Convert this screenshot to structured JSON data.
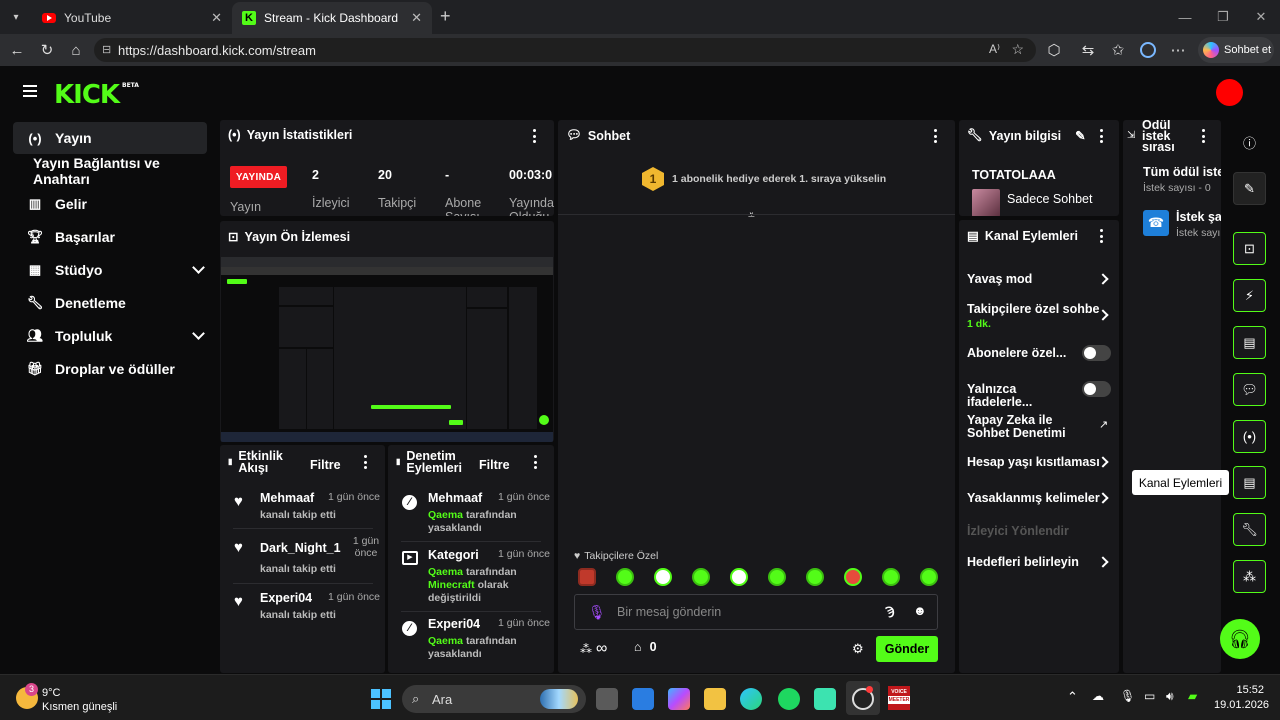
{
  "browser": {
    "tabs": [
      {
        "title": "YouTube"
      },
      {
        "title": "Stream - Kick Dashboard"
      }
    ],
    "url": "https://dashboard.kick.com/stream",
    "copilot_label": "Sohbet et"
  },
  "brand": {
    "logo": "KICK",
    "beta": "BETA",
    "accent": "#53fc18"
  },
  "sidebar": {
    "items": [
      {
        "label": "Yayın",
        "icon": "broadcast-icon"
      },
      {
        "label": "Yayın Bağlantısı ve Anahtarı"
      },
      {
        "label": "Gelir",
        "icon": "chart-icon"
      },
      {
        "label": "Başarılar",
        "icon": "trophy-icon"
      },
      {
        "label": "Stüdyo",
        "icon": "studio-icon"
      },
      {
        "label": "Denetleme",
        "icon": "wrench-icon"
      },
      {
        "label": "Topluluk",
        "icon": "users-icon"
      },
      {
        "label": "Droplar ve ödüller",
        "icon": "gift-icon"
      }
    ]
  },
  "stats": {
    "title": "Yayın İstatistikleri",
    "live_badge": "YAYINDA",
    "live_label": "Yayın",
    "viewers_value": "2",
    "viewers_label": "İzleyici",
    "followers_value": "20",
    "followers_label": "Takipçi",
    "subs_value": "-",
    "subs_label": "Abone Sayısı",
    "uptime_value": "00:03:0",
    "uptime_label": "Yayında Olduğu"
  },
  "preview": {
    "title": "Yayın Ön İzlemesi"
  },
  "activity": {
    "title": "Etkinlik Akışı",
    "filter": "Filtre",
    "items": [
      {
        "name": "Mehmaaf",
        "time": "1 gün önce",
        "desc": "kanalı takip etti"
      },
      {
        "name": "Dark_Night_1",
        "time": "1 gün önce",
        "desc": "kanalı takip etti"
      },
      {
        "name": "Experi04",
        "time": "1 gün önce",
        "desc": "kanalı takip etti"
      }
    ]
  },
  "moderation": {
    "title": "Denetim Eylemleri",
    "filter": "Filtre",
    "items": [
      {
        "name": "Mehmaaf",
        "time": "1 gün önce",
        "actor": "Qaema",
        "desc": "tarafından yasaklandı"
      },
      {
        "name": "Kategori",
        "time": "1 gün önce",
        "actor": "Qaema",
        "desc1": "tarafından",
        "category": "Minecraft",
        "desc2": "olarak değiştirildi"
      },
      {
        "name": "Experi04",
        "time": "1 gün önce",
        "actor": "Qaema",
        "desc": "tarafından yasaklandı"
      }
    ]
  },
  "chat": {
    "title": "Sohbet",
    "gift_text": "1 abonelik hediye ederek 1. sıraya yükselin",
    "gift_rank": "1",
    "followers_only": "Takipçilere Özel",
    "input_placeholder": "Bir mesaj gönderin",
    "points": "∞",
    "store_count": "0",
    "send": "Gönder"
  },
  "stream_info": {
    "title": "Yayın bilgisi",
    "stream_title": "TOTATOLAAA",
    "category": "Sadece Sohbet"
  },
  "channel_actions": {
    "title": "Kanal Eylemleri",
    "slow_mode": "Yavaş mod",
    "followers_chat": "Takipçilere özel sohbe",
    "followers_chat_value": "1 dk.",
    "subs_only": "Abonelere özel...",
    "emotes_only": "Yalnızca ifadelerle...",
    "ai_moderation_1": "Yapay Zeka ile",
    "ai_moderation_2": "Sohbet Denetimi",
    "age_restriction": "Hesap yaşı kısıtlaması",
    "banned_words": "Yasaklanmış kelimeler",
    "redirect": "İzleyici Yönlendir",
    "goals": "Hedefleri belirleyin"
  },
  "rewards": {
    "title_1": "Ödül",
    "title_2": "istek",
    "title_3": "sırası",
    "all_requests": "Tüm ödül istel",
    "request_count": "İstek sayısı - 0",
    "item_title": "İstek şa",
    "item_sub": "İstek sayı"
  },
  "right_rail": {
    "tooltip": "Kanal Eylemleri"
  },
  "taskbar": {
    "weather_temp": "9°C",
    "weather_desc": "Kısmen güneşli",
    "weather_badge": "3",
    "search": "Ara",
    "time": "15:52",
    "date": "19.01.2026",
    "voicemeeter_1": "VOICE",
    "voicemeeter_2": "MEETER"
  }
}
